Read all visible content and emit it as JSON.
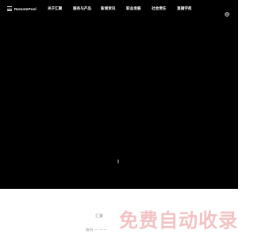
{
  "header": {
    "logo_text": "RemotePool",
    "menu": [
      {
        "label": "关于汇聚"
      },
      {
        "label": "服务与产品"
      },
      {
        "label": "新闻资讯"
      },
      {
        "label": "职业发展"
      },
      {
        "label": "社会责任"
      },
      {
        "label": "直播学苑"
      }
    ],
    "globe_icon": "globe-icon"
  },
  "hero": {
    "background": "#000000"
  },
  "footer": {
    "line1": "汇聚",
    "line2": "备份  一  一   一  ",
    "watermark": "免费自动收录"
  },
  "colors": {
    "accent": "#e53935",
    "nav_text": "#ffffff"
  }
}
